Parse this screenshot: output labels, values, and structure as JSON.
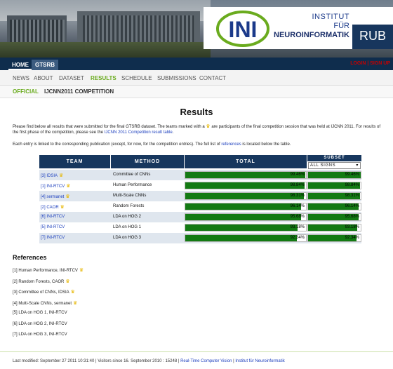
{
  "header": {
    "institute_line1": "INSTITUT",
    "institute_line2": "FÜR",
    "institute_line3": "NEUROINFORMATIK",
    "logo_text": "INI",
    "university": "RUB",
    "brand_color": "#17375e"
  },
  "topnav": {
    "tabs": [
      "HOME",
      "GTSRB"
    ],
    "login": "LOGIN | SIGN UP"
  },
  "subnav": {
    "items": [
      "NEWS",
      "ABOUT",
      "DATASET",
      "RESULTS",
      "SCHEDULE",
      "SUBMISSIONS",
      "CONTACT"
    ],
    "active": "RESULTS"
  },
  "subnav2": {
    "items": [
      "OFFICIAL",
      "IJCNN2011 COMPETITION"
    ]
  },
  "page": {
    "title": "Results",
    "intro_a": "Please find below all results that were submitted for the final GTSRB dataset. The teams marked with a",
    "intro_b": "are participants of the final competition session that was held at IJCNN 2011. For results of the first phase of the competition, please see the",
    "intro_link": "IJCNN 2011 Competition result table",
    "intro_c": ".",
    "note_a": "Each entry is linked to the corresponding publication (except, for now, for the competition entries). The full list of",
    "note_link": "references",
    "note_b": "is located below the table."
  },
  "table": {
    "headers": {
      "team": "TEAM",
      "method": "METHOD",
      "total": "TOTAL",
      "subset": "SUBSET"
    },
    "subset_selected": "ALL SIGNS",
    "rows": [
      {
        "team": "[3] IDSIA",
        "crown": true,
        "method": "Committee of CNNs",
        "total": "99.46%",
        "subset": "99.46%",
        "total_pct": 99.46,
        "subset_pct": 99.46
      },
      {
        "team": "[1] INI-RTCV",
        "crown": true,
        "method": "Human Performance",
        "total": "98.84%",
        "subset": "98.84%",
        "total_pct": 98.84,
        "subset_pct": 98.84
      },
      {
        "team": "[4] sermanet",
        "crown": true,
        "method": "Multi-Scale CNNs",
        "total": "98.31%",
        "subset": "98.31%",
        "total_pct": 98.31,
        "subset_pct": 98.31
      },
      {
        "team": "[2] CAOR",
        "crown": true,
        "method": "Random Forests",
        "total": "96.14%",
        "subset": "96.14%",
        "total_pct": 96.14,
        "subset_pct": 96.14
      },
      {
        "team": "[6] INI-RTCV",
        "crown": false,
        "method": "LDA on HOG 2",
        "total": "95.68%",
        "subset": "95.68%",
        "total_pct": 95.68,
        "subset_pct": 95.68
      },
      {
        "team": "[5] INI-RTCV",
        "crown": false,
        "method": "LDA on HOG 1",
        "total": "93.18%",
        "subset": "93.18%",
        "total_pct": 93.18,
        "subset_pct": 93.18
      },
      {
        "team": "[7] INI-RTCV",
        "crown": false,
        "method": "LDA on HOG 3",
        "total": "92.34%",
        "subset": "92.34%",
        "total_pct": 92.34,
        "subset_pct": 92.34
      }
    ]
  },
  "references": {
    "title": "References",
    "items": [
      {
        "text": "[1] Human Performance, INI-RTCV",
        "crown": true
      },
      {
        "text": "[2] Random Forests, CAOR",
        "crown": true
      },
      {
        "text": "[3] Committee of CNNs, IDSIA",
        "crown": true
      },
      {
        "text": "[4] Multi-Scale CNNs, sermanet",
        "crown": true
      },
      {
        "text": "[5] LDA on HOG 1, INI-RTCV",
        "crown": false
      },
      {
        "text": "[6] LDA on HOG 2, INI-RTCV",
        "crown": false
      },
      {
        "text": "[7] LDA on HOG 3, INI-RTCV",
        "crown": false
      }
    ]
  },
  "footer": {
    "text": "Last modified: September 27 2011 10:31:40 | Visitors since 16. September 2010 : 15248 |",
    "link1": "Real-Time Computer Vision",
    "sep": "|",
    "link2": "Institut für Neuroinformatik"
  },
  "colors": {
    "bar": "#137a13",
    "active_nav": "#6aab1e",
    "link": "#1a3dbd",
    "login": "#c60000"
  }
}
